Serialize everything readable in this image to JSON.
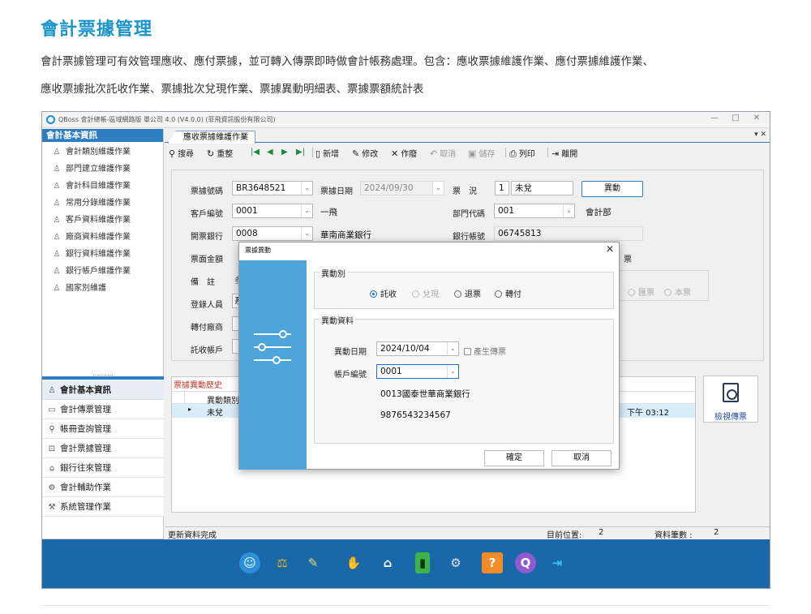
{
  "page": {
    "title": "會計票據管理",
    "intro_line1": "會計票據管理可有效管理應收、應付票據，並可轉入傳票即時做會計帳務處理。包含：應收票據維護作業、應付票據維護作業、",
    "intro_line2": "應收票據批次託收作業、票據批次兌現作業、票據異動明細表、票據票額統計表"
  },
  "window": {
    "title": "QBoss 會計總帳-區域網路版 單公司 4.0 (V4.0.0) (菲飛資訊股份有限公司)",
    "min": "—",
    "max": "□",
    "close": "✕"
  },
  "sidebar": {
    "header": "會計基本資訊",
    "items": [
      {
        "label": "會計類別維護作業"
      },
      {
        "label": "部門建立維護作業"
      },
      {
        "label": "會計科目維護作業"
      },
      {
        "label": "常用分錄維護作業"
      },
      {
        "label": "客戶資料維護作業"
      },
      {
        "label": "廠商資料維護作業"
      },
      {
        "label": "銀行資料維護作業"
      },
      {
        "label": "銀行帳戶維護作業"
      },
      {
        "label": "國家別維護"
      }
    ],
    "dots": "..........",
    "nav": [
      {
        "label": "會計基本資訊",
        "icon": "person-icon"
      },
      {
        "label": "會計傳票管理",
        "icon": "folder-icon"
      },
      {
        "label": "帳冊查詢管理",
        "icon": "search-icon"
      },
      {
        "label": "會計票據管理",
        "icon": "ticket-icon"
      },
      {
        "label": "銀行往來管理",
        "icon": "bank-icon"
      },
      {
        "label": "會計輔助作業",
        "icon": "gear-icon"
      },
      {
        "label": "系統管理作業",
        "icon": "tools-icon"
      }
    ],
    "footer_arrow": "⌄"
  },
  "main": {
    "tab": "應收票據維護作業",
    "tab_ctrl": "▾ ✕",
    "toolbar": {
      "search": "搜尋",
      "reset": "重整",
      "first": "|◀",
      "prev": "◀",
      "next": "▶",
      "last": "▶|",
      "new": "新增",
      "edit": "修改",
      "void": "作廢",
      "cancel": "取消",
      "save": "儲存",
      "print": "列印",
      "exit": "離開"
    },
    "form": {
      "bill_no_label": "票據號碼",
      "bill_no": "BR3648521",
      "bill_date_label": "票據日期",
      "bill_date": "2024/09/30",
      "status_label": "票　況",
      "status_code": "1",
      "status_text": "未兌",
      "change_button": "異動",
      "customer_label": "客戶編號",
      "customer_no": "0001",
      "customer_name": "一飛",
      "dept_label": "部門代碼",
      "dept_code": "001",
      "dept_name": "會計部",
      "bank_label": "開票銀行",
      "bank_code": "0008",
      "bank_name": "華南商業銀行",
      "account_label": "銀行帳號",
      "account_no": "06745813",
      "amount_label": "票面金額",
      "note_label": "備　註",
      "note_partial": "叁",
      "register_label": "登錄人員",
      "register_partial": "系",
      "transfer_label": "轉付廠商",
      "collect_label": "託收帳戶",
      "behind_trail": "票",
      "behind_radio1": "匯票",
      "behind_radio2": "本票"
    },
    "history": {
      "title": "票據異動歷史",
      "col_type": "異動類別",
      "row_type": "未兌",
      "row_time": "下午 03:12"
    },
    "view_button": "檢視傳票",
    "status": {
      "message": "更新資料完成",
      "position_label": "目前位置:",
      "position_value": "2",
      "count_label": "資料筆數 :",
      "count_value": "2"
    }
  },
  "modal": {
    "title": "票據異動",
    "close": "✕",
    "type_group": "異動別",
    "radios": [
      {
        "label": "託收",
        "selected": true,
        "disabled": false
      },
      {
        "label": "兌現",
        "selected": false,
        "disabled": true
      },
      {
        "label": "退票",
        "selected": false,
        "disabled": false
      },
      {
        "label": "轉付",
        "selected": false,
        "disabled": false
      }
    ],
    "data_group": "異動資料",
    "date_label": "異動日期",
    "date_value": "2024/10/04",
    "voucher_check": "產生傳票",
    "account_label": "帳戶編號",
    "account_value": "0001",
    "bank_line": "0013國泰世華商業銀行",
    "account_line": "9876543234567",
    "ok": "確定",
    "cancel": "取消"
  },
  "colors": {
    "accent": "#1b95c8",
    "header_blue": "#2f7dc1",
    "dock": "#1a68a7",
    "modal_side": "#4ea5d9"
  }
}
